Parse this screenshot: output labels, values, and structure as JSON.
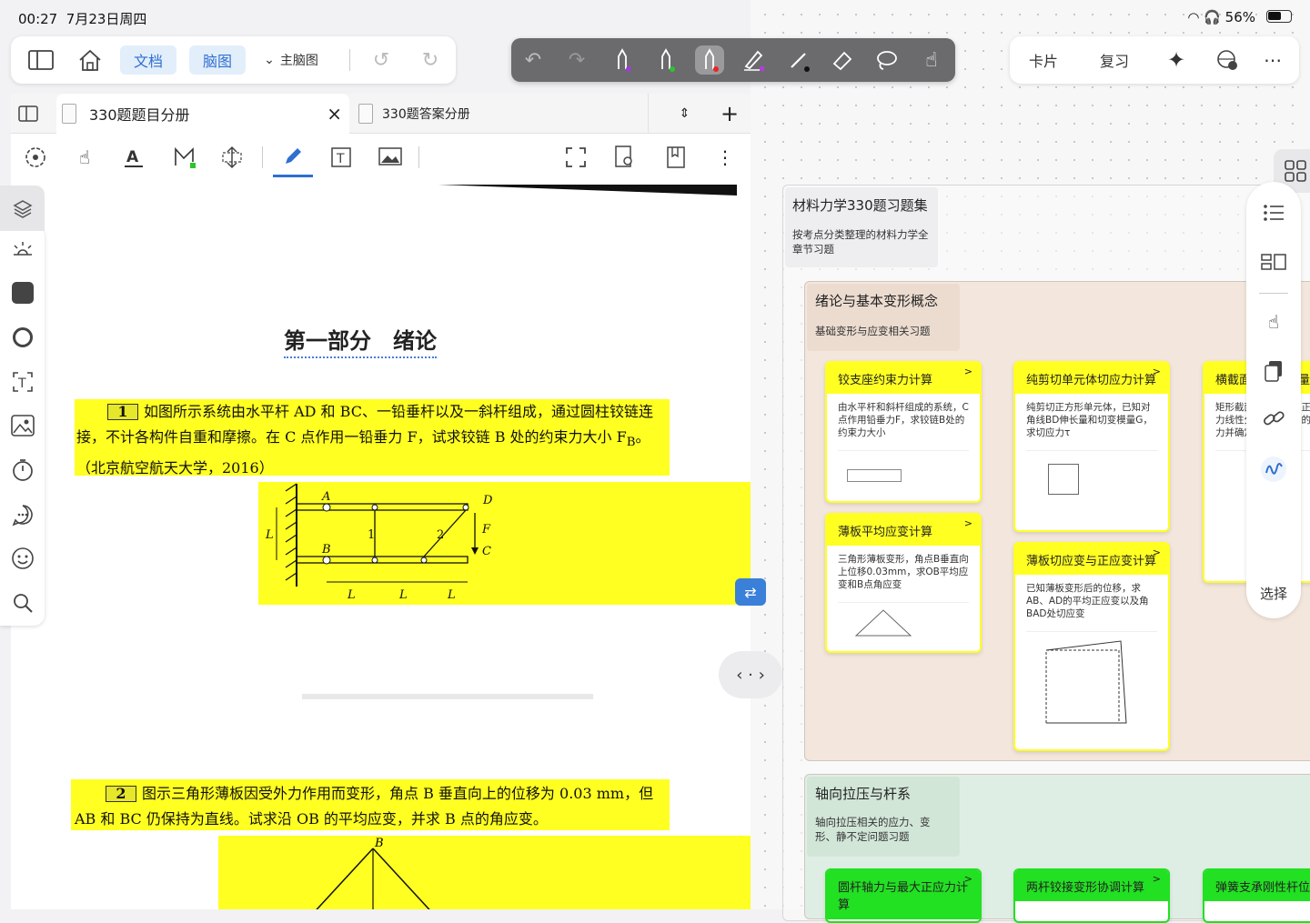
{
  "status": {
    "time": "00:27",
    "date": "7月23日周四",
    "battery": "56%"
  },
  "topbar": {
    "doc_label": "文档",
    "mindmap_label": "脑图",
    "main_mindmap": "主脑图"
  },
  "topright": {
    "cards": "卡片",
    "review": "复习"
  },
  "tabs": [
    {
      "label": "330题题目分册"
    },
    {
      "label": "330题答案分册"
    }
  ],
  "page": {
    "section_title": "第一部分　绪论",
    "q1_num": "1",
    "q1_text": "如图所示系统由水平杆 AD 和 BC、一铅垂杆以及一斜杆组成，通过圆柱铰链连接，不计各构件自重和摩擦。在 C 点作用一铅垂力 F，试求铰链 B 处的约束力大小 F",
    "q1_sub": "B",
    "q1_tail": "。（北京航空航天大学，2016）",
    "q2_num": "2",
    "q2_text": "图示三角形薄板因受外力作用而变形，角点 B 垂直向上的位移为 0.03 mm，但 AB 和 BC 仍保持为直线。试求沿 OB 的平均应变，并求 B 点的角应变。",
    "fig1": {
      "A": "A",
      "B": "B",
      "C": "C",
      "D": "D",
      "F": "F",
      "L": "L",
      "n1": "1",
      "n2": "2"
    },
    "fig2": {
      "B": "B"
    }
  },
  "mindmap": {
    "root_title": "材料力学330题习题集",
    "root_sub": "按考点分类整理的材料力学全章节习题",
    "group1": {
      "title": "绪论与基本变形概念",
      "sub": "基础变形与应变相关习题",
      "cards": [
        {
          "title": "铰支座约束力计算",
          "body": "由水平杆和斜杆组成的系统，C点作用铅垂力F，求铰链B处的约束力大小"
        },
        {
          "title": "纯剪切单元体切应力计算",
          "body": "纯剪切正方形单元体，已知对角线BD伸长量和切变模量G，求切应力τ"
        },
        {
          "title": "横截面上内力分量",
          "body": "矩形截面杆横截面上正应力线性分布，求存在的内力并确定大小"
        },
        {
          "title": "薄板平均应变计算",
          "body": "三角形薄板变形，角点B垂直向上位移0.03mm，求OB平均应变和B点角应变"
        },
        {
          "title": "薄板切应变与正应变计算",
          "body": "已知薄板变形后的位移，求AB、AD的平均正应变以及角BAD处切应变"
        }
      ]
    },
    "group2": {
      "title": "轴向拉压与杆系",
      "sub": "轴向拉压相关的应力、变形、静不定问题习题",
      "cards": [
        {
          "title": "圆杆轴力与最大正应力计算"
        },
        {
          "title": "两杆铰接变形协调计算"
        },
        {
          "title": "弹簧支承刚性杆位移"
        }
      ]
    },
    "select_label": "选择"
  },
  "colors": {
    "highlight": "#ffff21",
    "green": "#22e022",
    "accent": "#2f6fd1",
    "group1_bg": "#f3e6dc",
    "group2_bg": "#dfeee4"
  }
}
